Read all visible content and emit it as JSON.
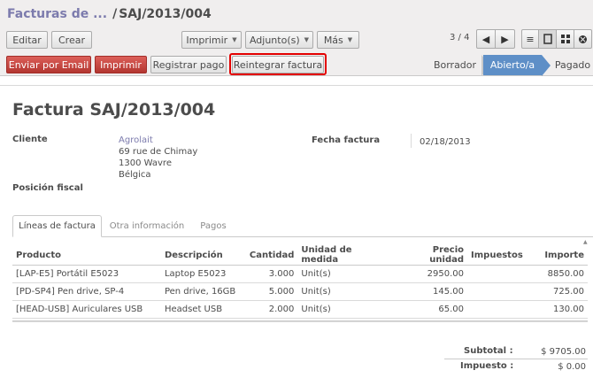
{
  "breadcrumb": {
    "parent": "Facturas de ...",
    "separator": "/",
    "current": "SAJ/2013/004"
  },
  "toolbar": {
    "edit_label": "Editar",
    "create_label": "Crear",
    "print_label": "Imprimir",
    "attachments_label": "Adjunto(s)",
    "more_label": "Más"
  },
  "pager": {
    "text": "3 / 4"
  },
  "actions": {
    "send_email_label": "Enviar por Email",
    "print_label": "Imprimir",
    "register_payment_label": "Registrar pago",
    "refund_label": "Reintegrar factura"
  },
  "status": {
    "steps": [
      "Borrador",
      "Abierto/a",
      "Pagado"
    ],
    "active": "Abierto/a"
  },
  "form": {
    "title": "Factura SAJ/2013/004",
    "customer_label": "Cliente",
    "customer_name": "Agrolait",
    "address_line1": "69 rue de Chimay",
    "address_line2": "1300 Wavre",
    "address_line3": "Bélgica",
    "fiscal_position_label": "Posición fiscal",
    "invoice_date_label": "Fecha factura",
    "invoice_date": "02/18/2013"
  },
  "tabs": [
    "Líneas de factura",
    "Otra información",
    "Pagos"
  ],
  "table": {
    "headers": [
      "Producto",
      "Descripción",
      "Cantidad",
      "Unidad de medida",
      "Precio unidad",
      "Impuestos",
      "Importe"
    ],
    "rows": [
      [
        "[LAP-E5] Portátil E5023",
        "Laptop E5023",
        "3.000",
        "Unit(s)",
        "2950.00",
        "",
        "8850.00"
      ],
      [
        "[PD-SP4] Pen drive, SP-4",
        "Pen drive, 16GB",
        "5.000",
        "Unit(s)",
        "145.00",
        "",
        "725.00"
      ],
      [
        "[HEAD-USB] Auriculares USB",
        "Headset USB",
        "2.000",
        "Unit(s)",
        "65.00",
        "",
        "130.00"
      ]
    ]
  },
  "totals": {
    "subtotal_label": "Subtotal :",
    "subtotal_value": "$ 9705.00",
    "tax_label": "Impuesto :",
    "tax_value": "$ 0.00"
  },
  "colors": {
    "accent": "#7c7bad",
    "primary_button": "#c9413b",
    "status_active": "#5e8fc7",
    "highlight": "#e30000"
  }
}
